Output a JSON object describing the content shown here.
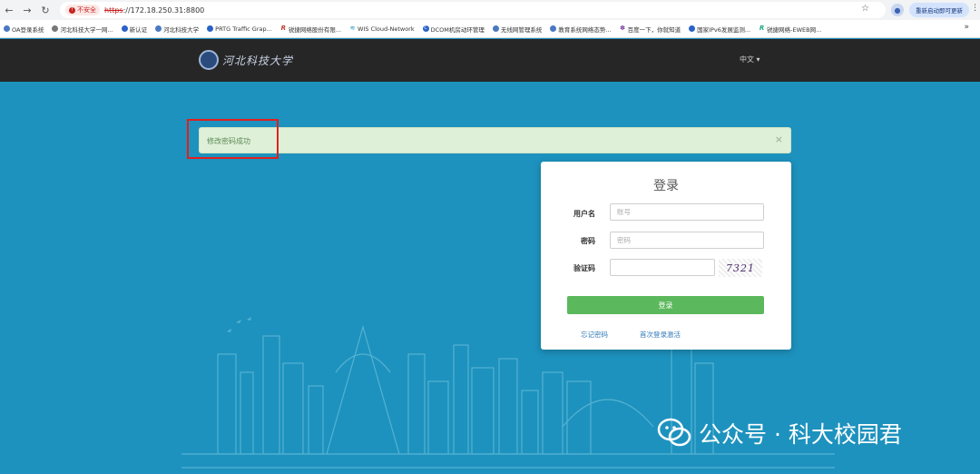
{
  "browser": {
    "security_label": "不安全",
    "url_scheme": "https",
    "url_rest": "://172.18.250.31:8800",
    "update_label": "重新启动即可更新"
  },
  "bookmarks": [
    {
      "label": "OA登录系统"
    },
    {
      "label": "河北科技大学一网..."
    },
    {
      "label": "新认证"
    },
    {
      "label": "河北科技大学"
    },
    {
      "label": "PRTG Traffic Grap..."
    },
    {
      "label": "锐捷网络股份有限..."
    },
    {
      "label": "WIS Cloud-Network"
    },
    {
      "label": "DCOM机房动环管理"
    },
    {
      "label": "无线网管理系统"
    },
    {
      "label": "教育系统网络态势..."
    },
    {
      "label": "百度一下，你就知道"
    },
    {
      "label": "国家IPv6发展监测..."
    },
    {
      "label": "锐捷网络-EWEB网..."
    }
  ],
  "header": {
    "logo_text": "河北科技大学",
    "language": "中文 ▾"
  },
  "alert": {
    "message": "修改密码成功",
    "close": "×"
  },
  "login": {
    "title": "登录",
    "username_label": "用户名",
    "username_placeholder": "账号",
    "password_label": "密码",
    "password_placeholder": "密码",
    "captcha_label": "验证码",
    "captcha_value": "7321",
    "submit": "登录",
    "forgot": "忘记密码",
    "first_login": "首次登录激活"
  },
  "watermark": {
    "text": "公众号 · 科大校园君"
  },
  "colors": {
    "page_bg": "#1d92be",
    "header_bg": "#262626",
    "alert_bg": "#dff0d8",
    "button_green": "#5cb85c",
    "highlight_red": "#e02020"
  }
}
